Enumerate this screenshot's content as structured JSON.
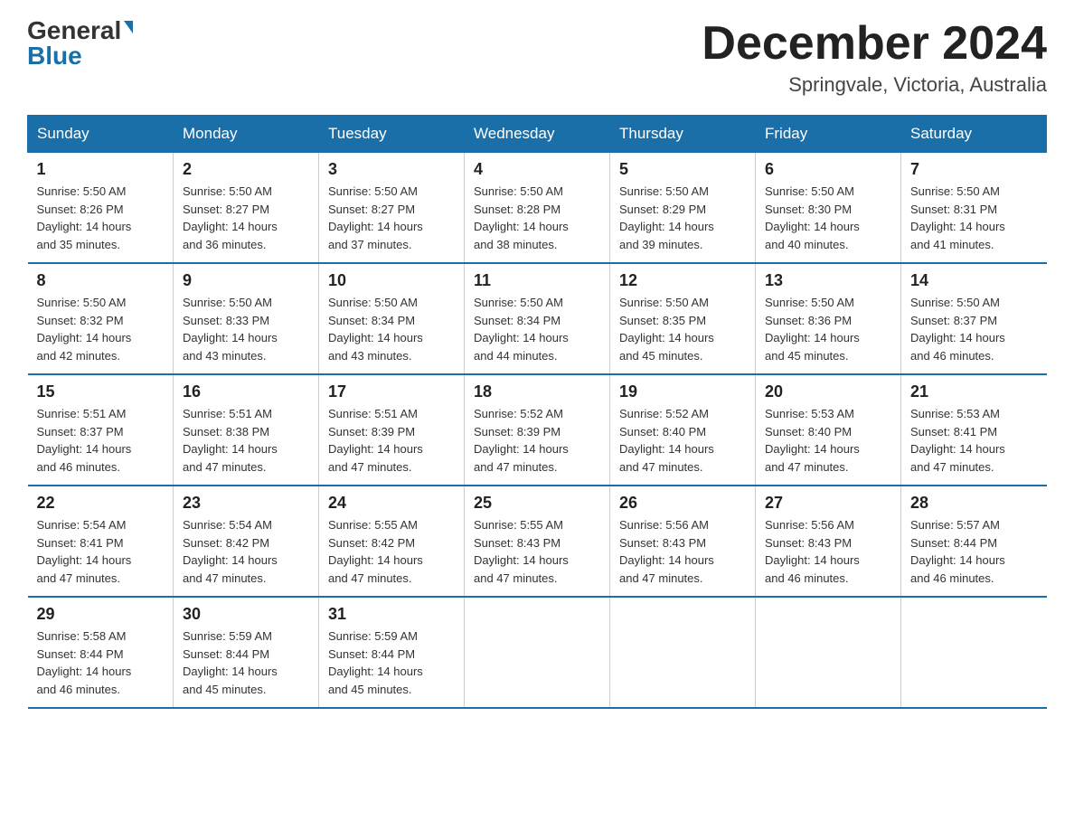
{
  "logo": {
    "general": "General",
    "blue": "Blue"
  },
  "title": "December 2024",
  "location": "Springvale, Victoria, Australia",
  "header_color": "#1a6fa8",
  "days_of_week": [
    "Sunday",
    "Monday",
    "Tuesday",
    "Wednesday",
    "Thursday",
    "Friday",
    "Saturday"
  ],
  "weeks": [
    [
      {
        "day": "1",
        "sunrise": "5:50 AM",
        "sunset": "8:26 PM",
        "daylight": "14 hours and 35 minutes."
      },
      {
        "day": "2",
        "sunrise": "5:50 AM",
        "sunset": "8:27 PM",
        "daylight": "14 hours and 36 minutes."
      },
      {
        "day": "3",
        "sunrise": "5:50 AM",
        "sunset": "8:27 PM",
        "daylight": "14 hours and 37 minutes."
      },
      {
        "day": "4",
        "sunrise": "5:50 AM",
        "sunset": "8:28 PM",
        "daylight": "14 hours and 38 minutes."
      },
      {
        "day": "5",
        "sunrise": "5:50 AM",
        "sunset": "8:29 PM",
        "daylight": "14 hours and 39 minutes."
      },
      {
        "day": "6",
        "sunrise": "5:50 AM",
        "sunset": "8:30 PM",
        "daylight": "14 hours and 40 minutes."
      },
      {
        "day": "7",
        "sunrise": "5:50 AM",
        "sunset": "8:31 PM",
        "daylight": "14 hours and 41 minutes."
      }
    ],
    [
      {
        "day": "8",
        "sunrise": "5:50 AM",
        "sunset": "8:32 PM",
        "daylight": "14 hours and 42 minutes."
      },
      {
        "day": "9",
        "sunrise": "5:50 AM",
        "sunset": "8:33 PM",
        "daylight": "14 hours and 43 minutes."
      },
      {
        "day": "10",
        "sunrise": "5:50 AM",
        "sunset": "8:34 PM",
        "daylight": "14 hours and 43 minutes."
      },
      {
        "day": "11",
        "sunrise": "5:50 AM",
        "sunset": "8:34 PM",
        "daylight": "14 hours and 44 minutes."
      },
      {
        "day": "12",
        "sunrise": "5:50 AM",
        "sunset": "8:35 PM",
        "daylight": "14 hours and 45 minutes."
      },
      {
        "day": "13",
        "sunrise": "5:50 AM",
        "sunset": "8:36 PM",
        "daylight": "14 hours and 45 minutes."
      },
      {
        "day": "14",
        "sunrise": "5:50 AM",
        "sunset": "8:37 PM",
        "daylight": "14 hours and 46 minutes."
      }
    ],
    [
      {
        "day": "15",
        "sunrise": "5:51 AM",
        "sunset": "8:37 PM",
        "daylight": "14 hours and 46 minutes."
      },
      {
        "day": "16",
        "sunrise": "5:51 AM",
        "sunset": "8:38 PM",
        "daylight": "14 hours and 47 minutes."
      },
      {
        "day": "17",
        "sunrise": "5:51 AM",
        "sunset": "8:39 PM",
        "daylight": "14 hours and 47 minutes."
      },
      {
        "day": "18",
        "sunrise": "5:52 AM",
        "sunset": "8:39 PM",
        "daylight": "14 hours and 47 minutes."
      },
      {
        "day": "19",
        "sunrise": "5:52 AM",
        "sunset": "8:40 PM",
        "daylight": "14 hours and 47 minutes."
      },
      {
        "day": "20",
        "sunrise": "5:53 AM",
        "sunset": "8:40 PM",
        "daylight": "14 hours and 47 minutes."
      },
      {
        "day": "21",
        "sunrise": "5:53 AM",
        "sunset": "8:41 PM",
        "daylight": "14 hours and 47 minutes."
      }
    ],
    [
      {
        "day": "22",
        "sunrise": "5:54 AM",
        "sunset": "8:41 PM",
        "daylight": "14 hours and 47 minutes."
      },
      {
        "day": "23",
        "sunrise": "5:54 AM",
        "sunset": "8:42 PM",
        "daylight": "14 hours and 47 minutes."
      },
      {
        "day": "24",
        "sunrise": "5:55 AM",
        "sunset": "8:42 PM",
        "daylight": "14 hours and 47 minutes."
      },
      {
        "day": "25",
        "sunrise": "5:55 AM",
        "sunset": "8:43 PM",
        "daylight": "14 hours and 47 minutes."
      },
      {
        "day": "26",
        "sunrise": "5:56 AM",
        "sunset": "8:43 PM",
        "daylight": "14 hours and 47 minutes."
      },
      {
        "day": "27",
        "sunrise": "5:56 AM",
        "sunset": "8:43 PM",
        "daylight": "14 hours and 46 minutes."
      },
      {
        "day": "28",
        "sunrise": "5:57 AM",
        "sunset": "8:44 PM",
        "daylight": "14 hours and 46 minutes."
      }
    ],
    [
      {
        "day": "29",
        "sunrise": "5:58 AM",
        "sunset": "8:44 PM",
        "daylight": "14 hours and 46 minutes."
      },
      {
        "day": "30",
        "sunrise": "5:59 AM",
        "sunset": "8:44 PM",
        "daylight": "14 hours and 45 minutes."
      },
      {
        "day": "31",
        "sunrise": "5:59 AM",
        "sunset": "8:44 PM",
        "daylight": "14 hours and 45 minutes."
      },
      null,
      null,
      null,
      null
    ]
  ],
  "labels": {
    "sunrise": "Sunrise:",
    "sunset": "Sunset:",
    "daylight": "Daylight:"
  }
}
